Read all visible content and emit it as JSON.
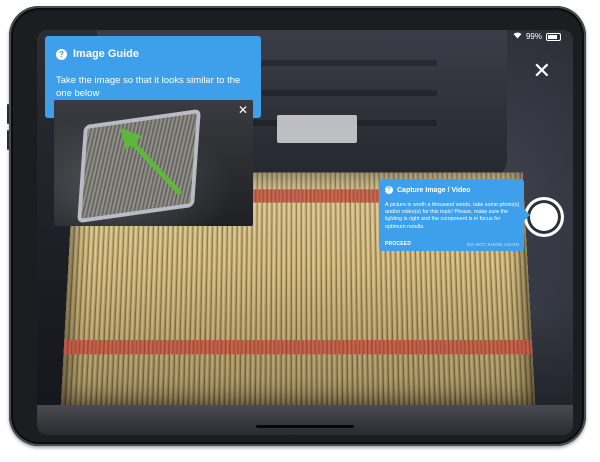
{
  "status_bar": {
    "battery": "99%"
  },
  "image_guide": {
    "title": "Image Guide",
    "instruction": "Take the image so that it looks similar to the one below"
  },
  "capture_tip": {
    "title": "Capture Image / Video",
    "body": "A picture is worth a thousand words, take some photo(s) and/or video(s) for this topic! Please, make sure the lighting is right and the component is in focus for optimum results.",
    "proceed_label": "PROCEED",
    "dont_show_label": "DO NOT SHOW AGAIN"
  },
  "icons": {
    "close": "close-icon",
    "help": "question-icon",
    "shutter": "shutter-button",
    "wifi": "wifi-icon",
    "battery": "battery-icon"
  },
  "colors": {
    "accent": "#3ea0ea",
    "arrow": "#5db83a"
  }
}
